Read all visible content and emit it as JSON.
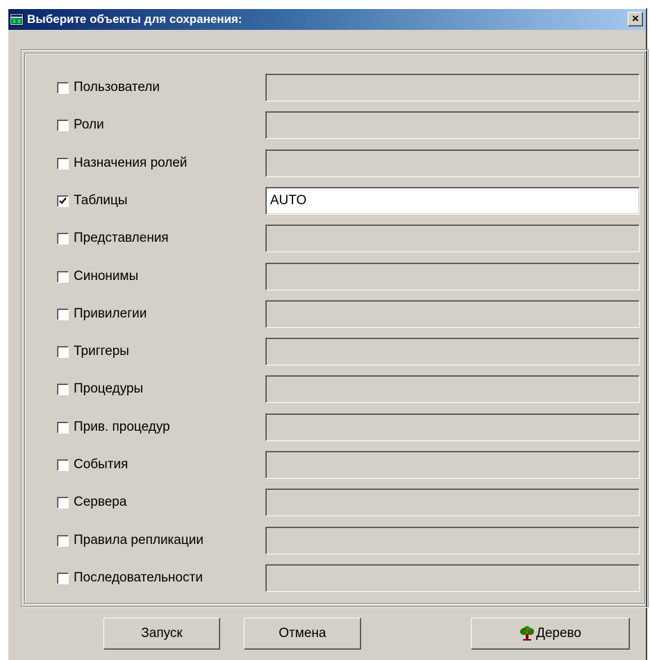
{
  "window": {
    "title": "Выберите объекты для сохранения:",
    "close_label": "×"
  },
  "items": [
    {
      "label": "Пользователи",
      "checked": false,
      "value": ""
    },
    {
      "label": "Роли",
      "checked": false,
      "value": ""
    },
    {
      "label": "Назначения ролей",
      "checked": false,
      "value": ""
    },
    {
      "label": "Таблицы",
      "checked": true,
      "value": "AUTO"
    },
    {
      "label": "Представления",
      "checked": false,
      "value": ""
    },
    {
      "label": "Синонимы",
      "checked": false,
      "value": ""
    },
    {
      "label": "Привилегии",
      "checked": false,
      "value": ""
    },
    {
      "label": "Триггеры",
      "checked": false,
      "value": ""
    },
    {
      "label": "Процедуры",
      "checked": false,
      "value": ""
    },
    {
      "label": "Прив. процедур",
      "checked": false,
      "value": ""
    },
    {
      "label": "События",
      "checked": false,
      "value": ""
    },
    {
      "label": "Сервера",
      "checked": false,
      "value": ""
    },
    {
      "label": "Правила репликации",
      "checked": false,
      "value": ""
    },
    {
      "label": "Последовательности",
      "checked": false,
      "value": ""
    }
  ],
  "buttons": {
    "run_label": "Запуск",
    "cancel_label": "Отмена",
    "tree_label": "Дерево",
    "tree_icon": "tree-icon"
  },
  "colors": {
    "title_start": "#0a246a",
    "title_end": "#a6caf0",
    "face": "#d4d0c8"
  }
}
